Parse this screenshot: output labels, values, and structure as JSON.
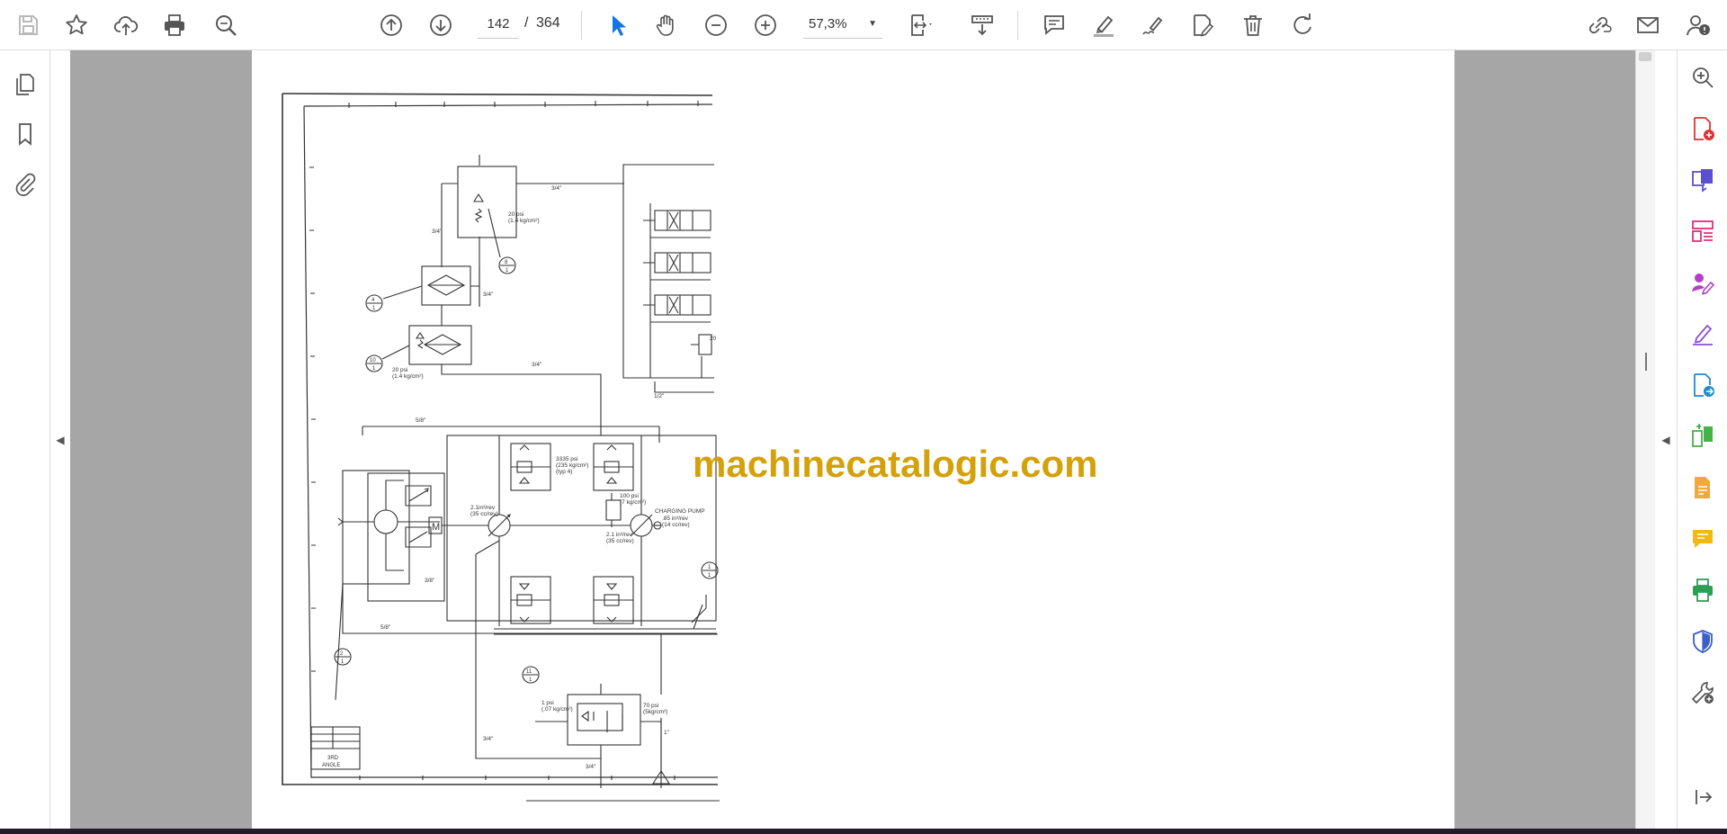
{
  "toolbar": {
    "page_current": "142",
    "page_separator": "/",
    "page_total": "364",
    "zoom": "57,3%",
    "icons": [
      "save-icon",
      "bookmark-star-icon",
      "cloud-upload-icon",
      "print-icon",
      "search-icon",
      "previous-page-icon",
      "next-page-icon",
      "select-cursor-icon",
      "hand-pan-icon",
      "zoom-out-icon",
      "zoom-in-icon",
      "fit-page-icon",
      "scroll-mode-icon",
      "comment-icon",
      "highlight-icon",
      "draw-icon",
      "fill-sign-icon",
      "delete-icon",
      "rotate-icon",
      "share-link-icon",
      "email-icon",
      "account-icon"
    ]
  },
  "left_nav": {
    "icons": [
      "page-thumbnails-icon",
      "bookmarks-icon",
      "attachments-icon"
    ]
  },
  "right_pane": {
    "icons": [
      "search-zoom-icon",
      "create-pdf-icon",
      "combine-files-icon",
      "organize-pages-icon",
      "request-signatures-icon",
      "fill-and-sign-icon",
      "export-pdf-icon",
      "compare-files-icon",
      "edit-pdf-icon",
      "comment-tool-icon",
      "print-production-icon",
      "protect-icon",
      "more-tools-icon",
      "expand-pane-icon"
    ]
  },
  "document": {
    "watermark": "machinecatalogic.com",
    "labels": {
      "p_3_4_a": "3/4\"",
      "p_3_4_b": "3/4\"",
      "p_3_4_c": "3/4\"",
      "p_3_4_d": "3/4\"",
      "p_3_4_e": "3/4\"",
      "p_3_4_f": "3/4\"",
      "p_1_2": "1/2\"",
      "p_5_8_a": "5/8\"",
      "p_5_8_b": "5/8\"",
      "p_3_8": "3/8\"",
      "p_1": "1\"",
      "psi20a": "20 psi",
      "kg20a": "(1.4 kg/cm²)",
      "psi20b": "20 psi",
      "kg20b": "(1.4 kg/cm²)",
      "psi3335": "3335 psi",
      "kg235": "(235 kg/cm²)",
      "typ4": "(typ 4)",
      "psi100": "100 psi",
      "kg7": "(7 kg/cm²)",
      "disp1": "2.1in³/rev",
      "cc1": "(35 cc/rev)",
      "disp2": "2.1 in³/rev",
      "cc2": "(35 cc/rev)",
      "charging": "CHARGING PUMP",
      "disp3": ".85 in³/rev",
      "cc3": "(14 cc/rev)",
      "psi1": "1 psi",
      "kg07": "(.07 kg/cm²)",
      "psi70": "70 psi",
      "kg5": "(5kg/cm²)",
      "psi20c": "20",
      "motor": "M",
      "c8a": "8",
      "c8b": "1",
      "c4a": "4",
      "c4b": "1",
      "c10a": "10",
      "c10b": "1",
      "c2a": "2",
      "c2b": "1",
      "c11a": "11",
      "c11b": "1",
      "c1a": "1",
      "c1b": "1",
      "third": "3RD",
      "angle": "ANGLE"
    }
  }
}
